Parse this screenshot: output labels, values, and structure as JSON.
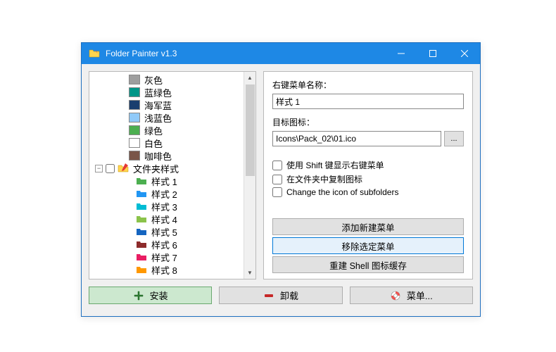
{
  "titlebar": {
    "title": "Folder Painter v1.3"
  },
  "tree": {
    "colors": [
      {
        "label": "灰色",
        "hex": "#9e9e9e"
      },
      {
        "label": "蓝绿色",
        "hex": "#009688"
      },
      {
        "label": "海军蓝",
        "hex": "#1a3e6e"
      },
      {
        "label": "浅蓝色",
        "hex": "#90caf9"
      },
      {
        "label": "绿色",
        "hex": "#4caf50"
      },
      {
        "label": "白色",
        "hex": "#ffffff"
      },
      {
        "label": "咖啡色",
        "hex": "#795548"
      }
    ],
    "style_parent": "文件夹样式",
    "styles": [
      {
        "label": "样式 1",
        "color": "#4caf50"
      },
      {
        "label": "样式 2",
        "color": "#2196f3"
      },
      {
        "label": "样式 3",
        "color": "#00bcd4"
      },
      {
        "label": "样式 4",
        "color": "#8bc34a"
      },
      {
        "label": "样式 5",
        "color": "#1565c0"
      },
      {
        "label": "样式 6",
        "color": "#8d2b2b"
      },
      {
        "label": "样式 7",
        "color": "#e91e63"
      },
      {
        "label": "样式 8",
        "color": "#ff9800"
      }
    ]
  },
  "right": {
    "name_label": "右键菜单名称：",
    "name_value": "样式 1",
    "icon_label": "目标图标：",
    "icon_value": "Icons\\Pack_02\\01.ico",
    "browse_label": "...",
    "checks": {
      "shift_label": "使用 Shift 键显示右键菜单",
      "copy_label": "在文件夹中复制图标",
      "subfolder_label": "Change the icon of subfolders"
    },
    "buttons": {
      "add": "添加新建菜单",
      "remove": "移除选定菜单",
      "rebuild": "重建 Shell 图标缓存"
    }
  },
  "bottom": {
    "install": "安装",
    "uninstall": "卸载",
    "menu": "菜单..."
  }
}
